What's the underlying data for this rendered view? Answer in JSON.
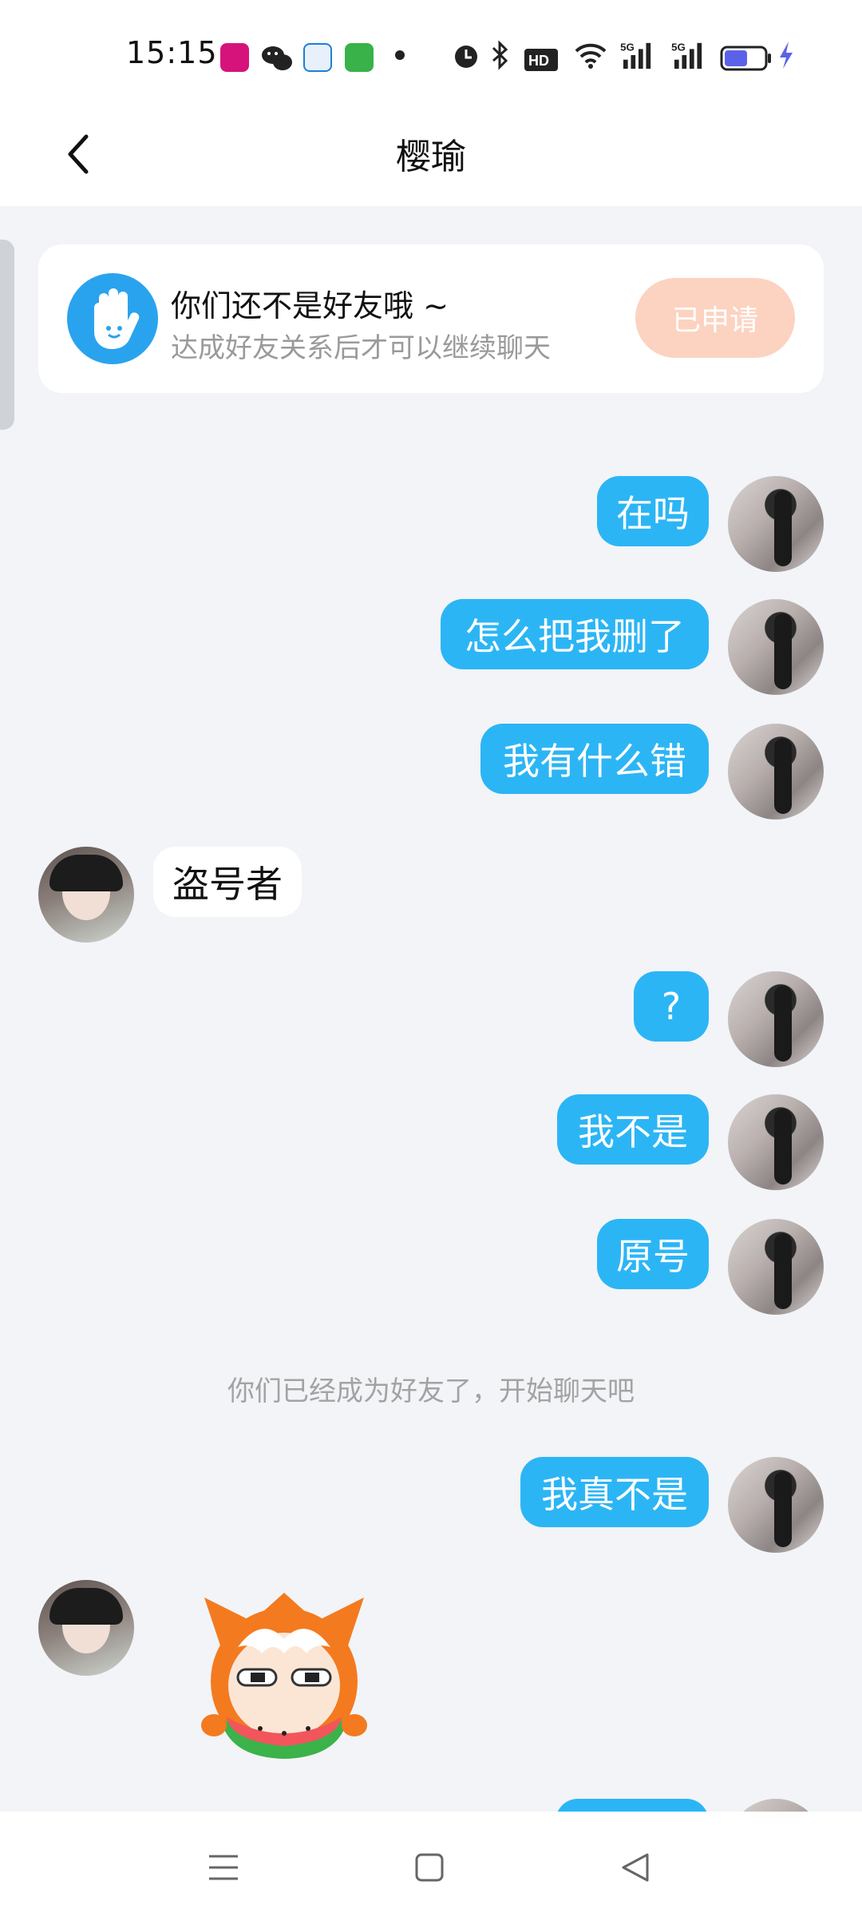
{
  "status_bar": {
    "time": "15:15",
    "icons": [
      "app-icon-pink",
      "wechat-icon",
      "app-icon-blue",
      "messages-icon",
      "dot",
      "alarm-icon",
      "bluetooth-icon",
      "hd-icon",
      "wifi-icon",
      "signal-5g-icon",
      "signal-5g-icon",
      "battery-icon",
      "charging-icon"
    ]
  },
  "header": {
    "title": "樱瑜",
    "back_icon": "chevron-left-icon"
  },
  "friend_card": {
    "title": "你们还不是好友哦 ~",
    "subtitle": "达成好友关系后才可以继续聊天",
    "button_label": "已申请",
    "icon": "wave-hand-icon"
  },
  "messages": [
    {
      "side": "out",
      "text": "在吗"
    },
    {
      "side": "out",
      "text": "怎么把我删了"
    },
    {
      "side": "out",
      "text": "我有什么错"
    },
    {
      "side": "in",
      "text": "盗号者"
    },
    {
      "side": "out",
      "text": "?"
    },
    {
      "side": "out",
      "text": "我不是"
    },
    {
      "side": "out",
      "text": "原号"
    },
    {
      "side": "system",
      "text": "你们已经成为好友了，开始聊天吧"
    },
    {
      "side": "out",
      "text": "我真不是"
    },
    {
      "side": "in",
      "sticker": "watermelon-sticker"
    }
  ],
  "bottom_nav": {
    "icons": [
      "menu-icon",
      "home-square-icon",
      "back-triangle-icon"
    ]
  },
  "colors": {
    "accent_blue": "#2cb5f5",
    "applied_button": "#fcd3c0",
    "background": "#f2f4f7"
  }
}
